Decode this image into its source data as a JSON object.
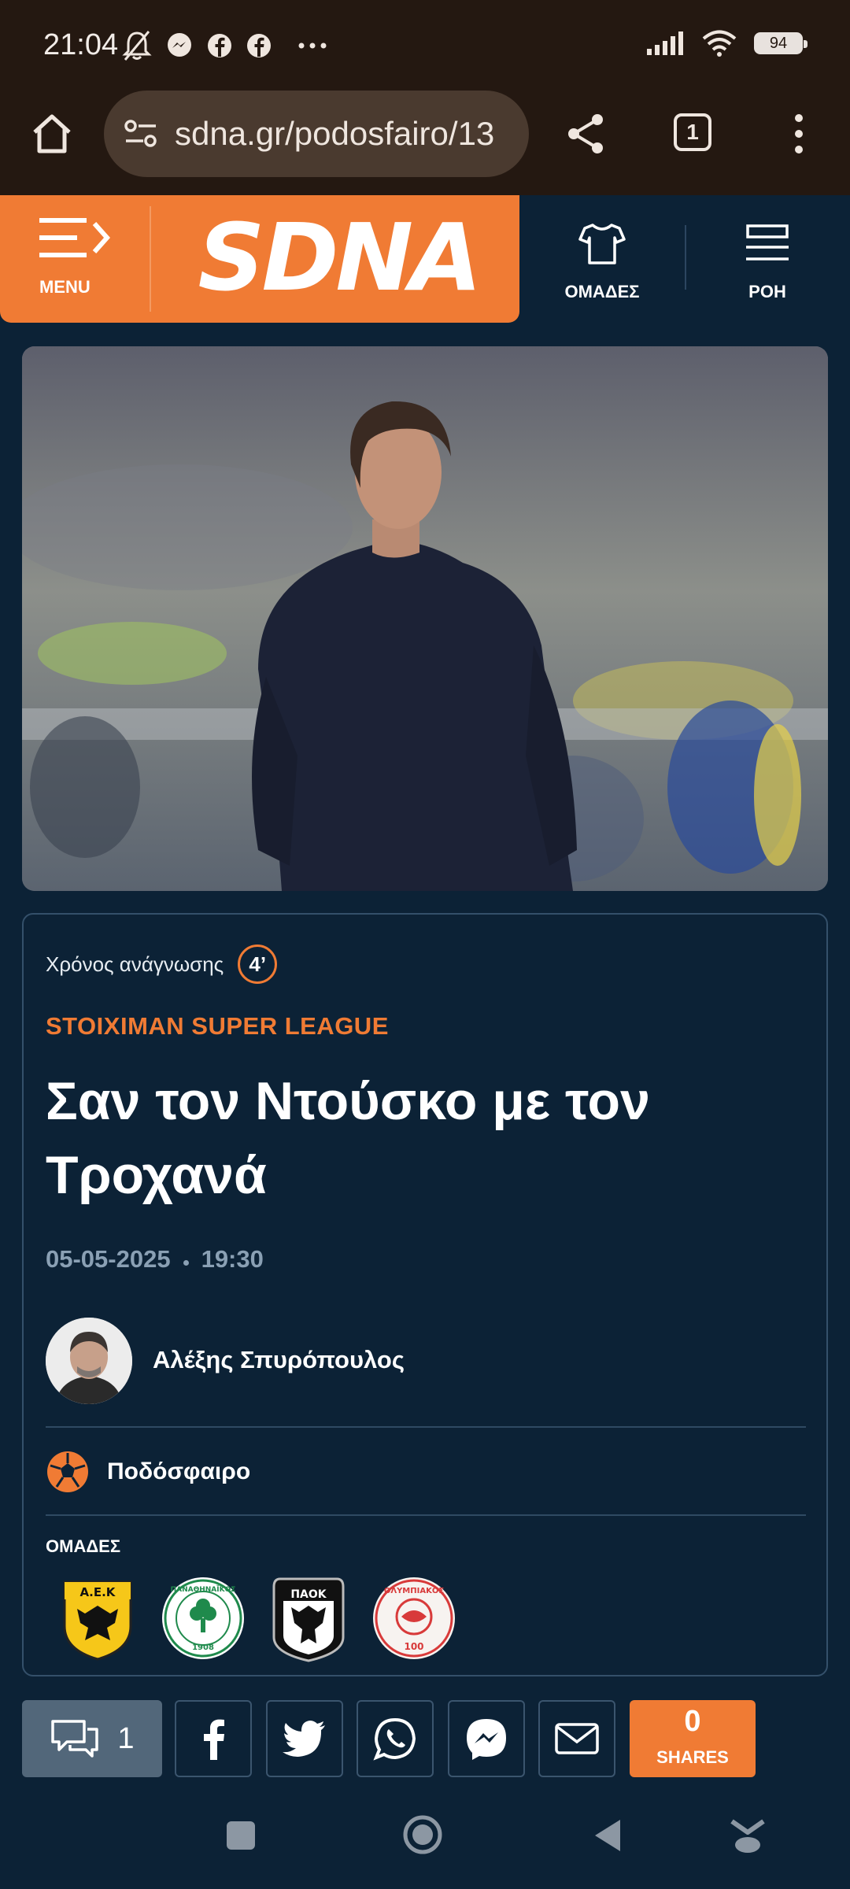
{
  "status_bar": {
    "time": "21:04",
    "battery": "94",
    "icons": [
      "bell-off-icon",
      "messenger-icon",
      "facebook-icon",
      "facebook-icon",
      "more-dots-icon",
      "signal-icon",
      "wifi-icon",
      "battery-icon"
    ]
  },
  "browser": {
    "url": "sdna.gr/podosfairo/13",
    "tab_count": "1"
  },
  "site_header": {
    "menu_label": "MENU",
    "logo_text": "SDNA",
    "teams_label": "ΟΜΑΔΕΣ",
    "feed_label": "ΡΟΗ",
    "accent_color": "#f07b34",
    "background_color": "#0c2236"
  },
  "article": {
    "reading_time_label": "Χρόνος ανάγνωσης",
    "reading_time_value": "4’",
    "category": "STOIXIMAN SUPER LEAGUE",
    "headline": "Σαν τον Ντούσκο με τον Τροχανά",
    "date": "05-05-2025",
    "time": "19:30",
    "author": "Αλέξης Σπυρόπουλος",
    "topic": "Ποδόσφαιρο",
    "teams_title": "ΟΜΑΔΕΣ",
    "teams": [
      {
        "name": "AEK",
        "logo_text": "Α.Ε.Κ"
      },
      {
        "name": "Panathinaikos",
        "logo_text": "ΠΑΝΑΘΗΝΑΪΚΟΣ"
      },
      {
        "name": "PAOK",
        "logo_text": "ΠΑΟΚ"
      },
      {
        "name": "Olympiacos",
        "logo_text": "ΟΛΥΜΠΙΑΚΟΣ"
      }
    ]
  },
  "share_bar": {
    "comments_count": "1",
    "shares_count": "0",
    "shares_label": "SHARES"
  }
}
